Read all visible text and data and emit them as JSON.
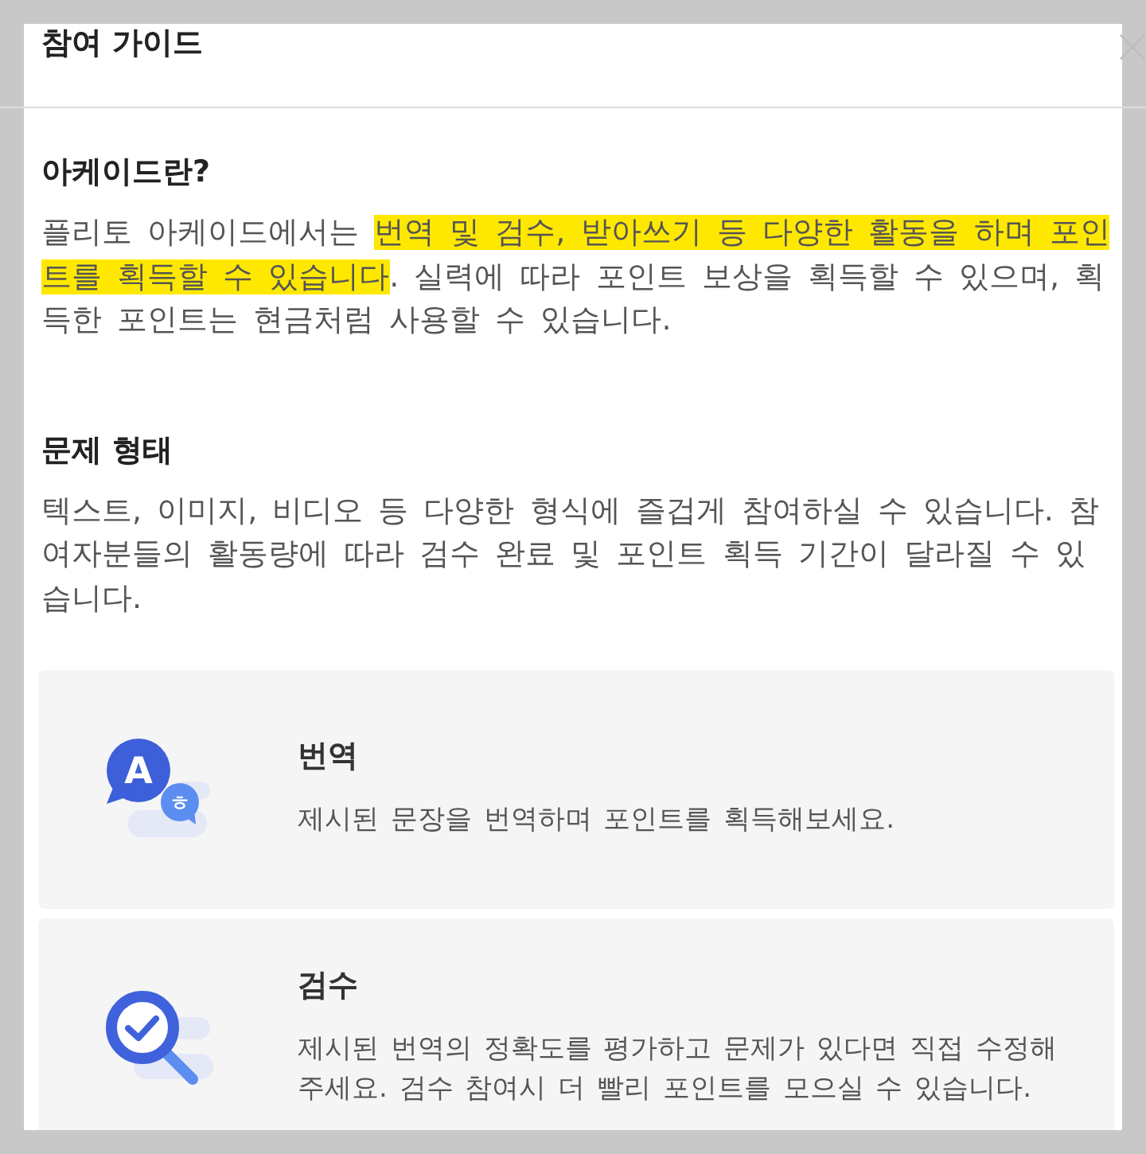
{
  "modal": {
    "title": "참여 가이드"
  },
  "sections": [
    {
      "heading": "아케이드란?",
      "segments": [
        {
          "text": "플리토 아케이드에서는 ",
          "highlighted": false
        },
        {
          "text": "번역 및 검수, 받아쓰기 등 다양한 활동을 하며 포인트를 획득할 수 있습니다",
          "highlighted": true
        },
        {
          "text": ". 실력에 따라 포인트 보상을 획득할 수 있으며, 획득한 포인트는 현금처럼 사용할 수 있습니다.",
          "highlighted": false
        }
      ]
    },
    {
      "heading": "문제 형태",
      "segments": [
        {
          "text": "텍스트, 이미지, 비디오 등 다양한 형식에 즐겁게 참여하실 수 있습니다. 참여자분들의 활동량에 따라 검수 완료 및 포인트 획득 기간이 달라질 수 있습니다.",
          "highlighted": false
        }
      ]
    }
  ],
  "task_types": [
    {
      "kind": "translate",
      "icon_letters": [
        "A",
        "ㅎ"
      ],
      "title": "번역",
      "description": "제시된 문장을 번역하며 포인트를 획득해보세요."
    },
    {
      "kind": "review",
      "title": "검수",
      "description": "제시된 번역의 정확도를 평가하고 문제가 있다면 직접 수정해 주세요. 검수 참여시 더 빨리 포인트를 모으실 수 있습니다."
    }
  ]
}
